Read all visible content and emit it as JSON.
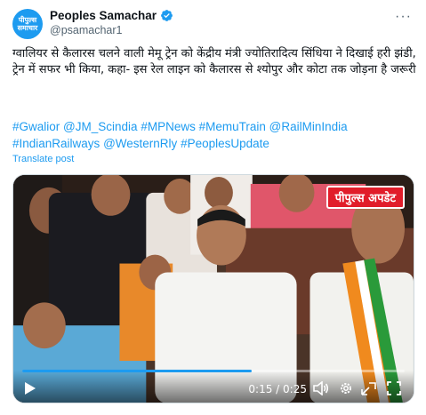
{
  "author": {
    "avatar_text": "पीपुल्स समाचार",
    "display_name": "Peoples Samachar",
    "handle": "@psamachar1",
    "more_label": "···"
  },
  "tweet": {
    "text": "ग्वालियर से कैलारस चलने वाली मेमू ट्रेन को केंद्रीय मंत्री ज्योतिरादित्य सिंधिया ने दिखाई हरी झंडी, ट्रेन में सफर भी किया, कहा- इस रेल लाइन को कैलारस से श्योपुर और कोटा तक जोड़ना है जरूरी",
    "hashtags": [
      "#Gwalior",
      "@JM_Scindia",
      "#MPNews",
      "#MemuTrain",
      "@RailMinIndia",
      "#IndianRailways",
      "@WesternRly",
      "#PeoplesUpdate"
    ],
    "translate_label": "Translate post"
  },
  "video": {
    "badge_text": "पीपुल्स अपडेट",
    "current_time": "0:15",
    "duration": "0:25",
    "progress_fraction": 0.6,
    "time_display": "0:15 / 0:25"
  },
  "colors": {
    "accent": "#1d9bf0",
    "text": "#0f1419",
    "muted": "#536471",
    "badge": "#e11d2a"
  },
  "icons": [
    "verified-badge-icon",
    "more-options-icon",
    "play-icon",
    "volume-icon",
    "settings-gear-icon",
    "picture-in-picture-icon",
    "fullscreen-icon"
  ]
}
